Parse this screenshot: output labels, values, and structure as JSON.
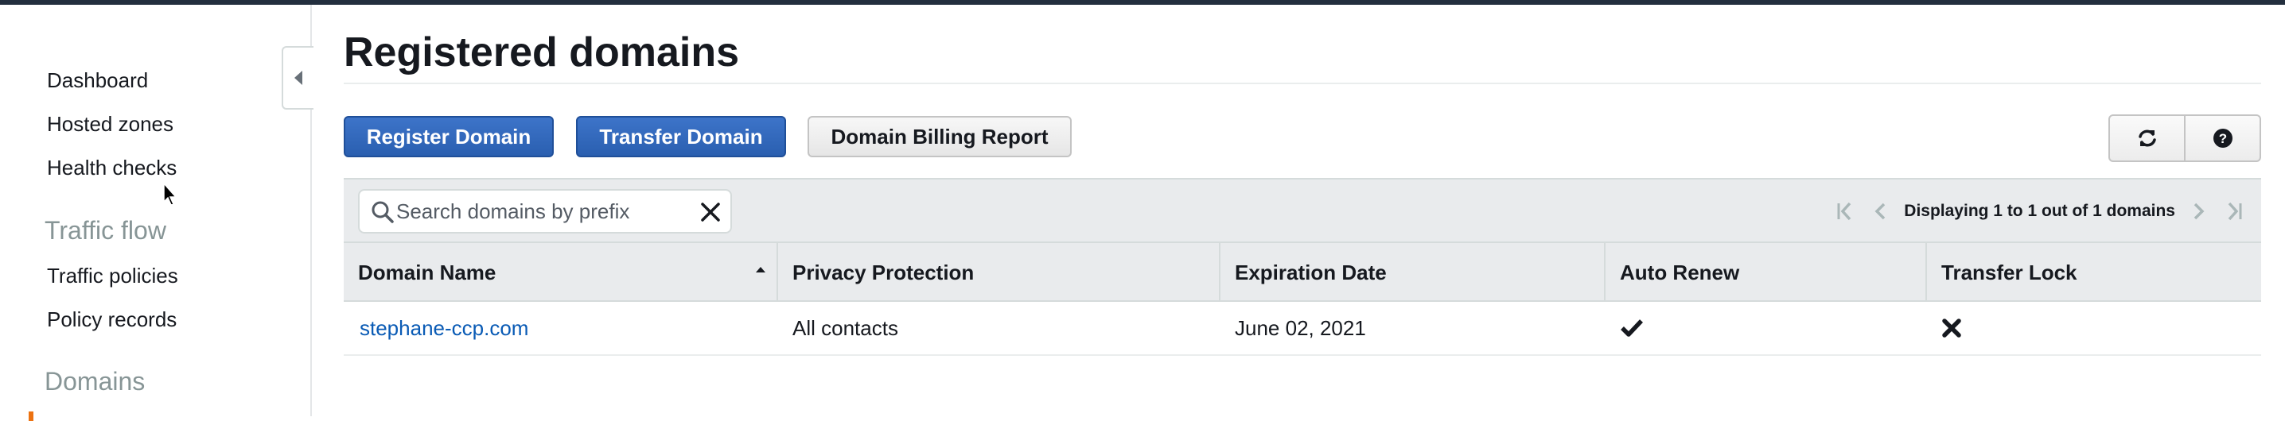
{
  "sidebar": {
    "items": [
      {
        "label": "Dashboard"
      },
      {
        "label": "Hosted zones"
      },
      {
        "label": "Health checks"
      }
    ],
    "traffic_flow": {
      "heading": "Traffic flow",
      "items": [
        {
          "label": "Traffic policies"
        },
        {
          "label": "Policy records"
        }
      ]
    },
    "domains_heading": "Domains"
  },
  "main": {
    "title": "Registered domains",
    "buttons": {
      "register": "Register Domain",
      "transfer": "Transfer Domain",
      "billing_report": "Domain Billing Report"
    },
    "icons": {
      "refresh": "refresh-icon",
      "help": "help-icon"
    },
    "search": {
      "placeholder": "Search domains by prefix",
      "value": ""
    },
    "pagination": {
      "text": "Displaying 1 to 1 out of 1 domains"
    },
    "table": {
      "columns": [
        "Domain Name",
        "Privacy Protection",
        "Expiration Date",
        "Auto Renew",
        "Transfer Lock"
      ],
      "sort": {
        "column": "Domain Name",
        "direction": "ascending"
      },
      "rows": [
        {
          "domain_name": "stephane-ccp.com",
          "privacy_protection": "All contacts",
          "expiration_date": "June 02, 2021",
          "auto_renew": "check-icon",
          "transfer_lock": "x-icon"
        }
      ]
    }
  },
  "colors": {
    "primary_button": "#2e64b8",
    "link": "#0a5bb5",
    "header_bar": "#232f3e",
    "table_header": "#e9ebed"
  }
}
